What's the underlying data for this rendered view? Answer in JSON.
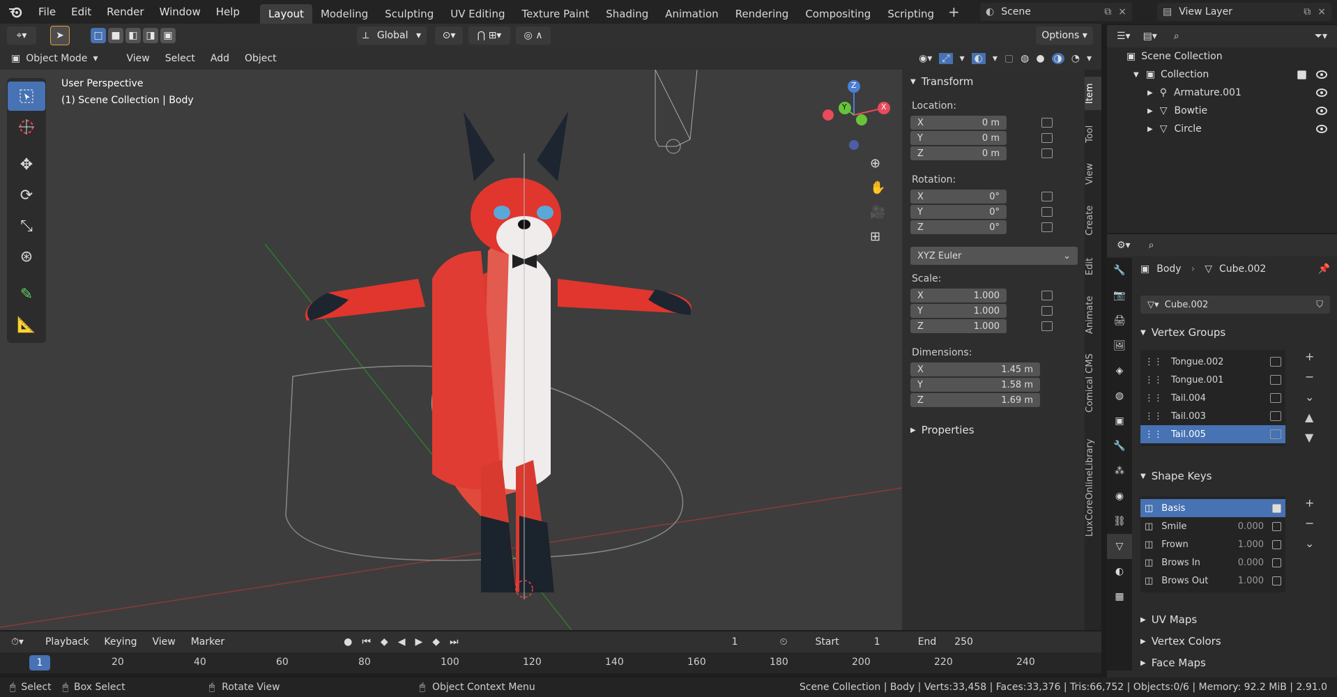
{
  "menu": [
    "File",
    "Edit",
    "Render",
    "Window",
    "Help"
  ],
  "workspaces": [
    {
      "label": "Layout",
      "active": true
    },
    {
      "label": "Modeling"
    },
    {
      "label": "Sculpting"
    },
    {
      "label": "UV Editing"
    },
    {
      "label": "Texture Paint"
    },
    {
      "label": "Shading"
    },
    {
      "label": "Animation"
    },
    {
      "label": "Rendering"
    },
    {
      "label": "Compositing"
    },
    {
      "label": "Scripting"
    }
  ],
  "scene": {
    "label": "Scene",
    "view_layer": "View Layer"
  },
  "viewport_header": {
    "transform_orientation": "Global",
    "options": "Options",
    "mode": "Object Mode",
    "menus": [
      "View",
      "Select",
      "Add",
      "Object"
    ]
  },
  "viewport": {
    "perspective": "User Perspective",
    "context": "(1) Scene Collection | Body",
    "axes": {
      "x": "X",
      "y": "Y",
      "z": "Z"
    }
  },
  "transform": {
    "title": "Transform",
    "location_label": "Location:",
    "location": [
      {
        "axis": "X",
        "value": "0 m"
      },
      {
        "axis": "Y",
        "value": "0 m"
      },
      {
        "axis": "Z",
        "value": "0 m"
      }
    ],
    "rotation_label": "Rotation:",
    "rotation": [
      {
        "axis": "X",
        "value": "0°"
      },
      {
        "axis": "Y",
        "value": "0°"
      },
      {
        "axis": "Z",
        "value": "0°"
      }
    ],
    "rotation_mode": "XYZ Euler",
    "scale_label": "Scale:",
    "scale": [
      {
        "axis": "X",
        "value": "1.000"
      },
      {
        "axis": "Y",
        "value": "1.000"
      },
      {
        "axis": "Z",
        "value": "1.000"
      }
    ],
    "dimensions_label": "Dimensions:",
    "dimensions": [
      {
        "axis": "X",
        "value": "1.45 m"
      },
      {
        "axis": "Y",
        "value": "1.58 m"
      },
      {
        "axis": "Z",
        "value": "1.69 m"
      }
    ],
    "properties": "Properties"
  },
  "npanel_tabs": [
    "Item",
    "Tool",
    "View",
    "Create",
    "Edit",
    "Animate",
    "Comical CMS",
    "LuxCoreOnlineLibrary"
  ],
  "outliner": {
    "root": "Scene Collection",
    "collection": "Collection",
    "items": [
      "Armature.001",
      "Bowtie",
      "Circle"
    ]
  },
  "properties": {
    "object": "Body",
    "mesh": "Cube.002",
    "datablock": "Cube.002",
    "vertex_groups_title": "Vertex Groups",
    "vertex_groups": [
      {
        "name": "Tongue.002"
      },
      {
        "name": "Tongue.001"
      },
      {
        "name": "Tail.004"
      },
      {
        "name": "Tail.003"
      },
      {
        "name": "Tail.005",
        "selected": true
      }
    ],
    "shape_keys_title": "Shape Keys",
    "shape_keys": [
      {
        "name": "Basis",
        "value": "",
        "selected": true,
        "checked": true
      },
      {
        "name": "Smile",
        "value": "0.000"
      },
      {
        "name": "Frown",
        "value": "1.000"
      },
      {
        "name": "Brows In",
        "value": "0.000"
      },
      {
        "name": "Brows Out",
        "value": "1.000"
      }
    ],
    "uv_maps": "UV Maps",
    "vertex_colors": "Vertex Colors",
    "face_maps": "Face Maps"
  },
  "timeline": {
    "menus": [
      "Playback",
      "Keying",
      "View",
      "Marker"
    ],
    "current_frame": "1",
    "start_label": "Start",
    "start": "1",
    "end_label": "End",
    "end": "250",
    "ruler": [
      "20",
      "40",
      "60",
      "80",
      "100",
      "120",
      "140",
      "160",
      "180",
      "200",
      "220",
      "240"
    ],
    "playhead": "1"
  },
  "status": {
    "select": "Select",
    "box_select": "Box Select",
    "rotate_view": "Rotate View",
    "context_menu": "Object Context Menu",
    "stats": "Scene Collection | Body | Verts:33,458 | Faces:33,376 | Tris:66,752 | Objects:0/6 | Memory: 92.2 MiB | 2.91.0"
  },
  "colors": {
    "accent": "#4772b3",
    "x_axis": "#e84b5a",
    "y_axis": "#67c43a",
    "z_axis": "#4a7fd6",
    "fox": "#e0362d"
  }
}
